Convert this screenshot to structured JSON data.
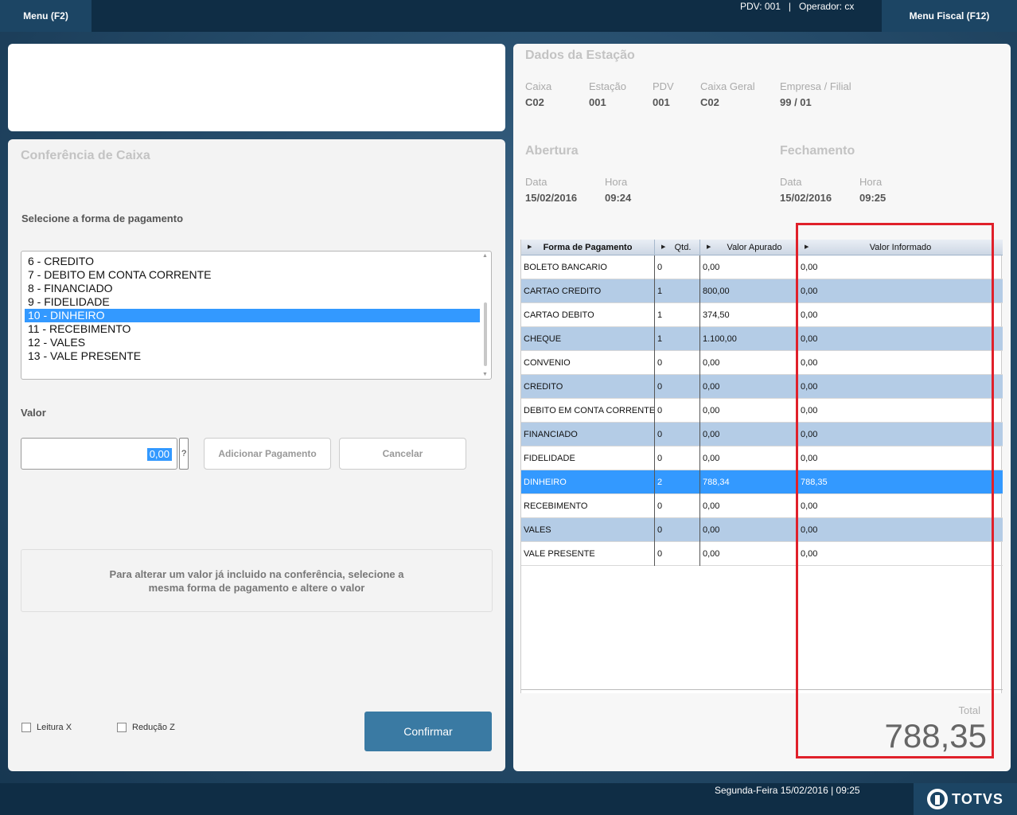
{
  "topbar": {
    "menu_left": "Menu (F2)",
    "menu_right": "Menu Fiscal (F12)",
    "pdv": "PDV: 001",
    "separator": "|",
    "operador": "Operador: cx"
  },
  "left_panel": {
    "title": "Conferência de Caixa",
    "select_label": "Selecione a forma de pagamento",
    "payment_options": [
      "6 - CREDITO",
      "7 - DEBITO EM CONTA CORRENTE",
      "8 - FINANCIADO",
      "9 - FIDELIDADE",
      "10 - DINHEIRO",
      "11 - RECEBIMENTO",
      "12 - VALES",
      "13 - VALE PRESENTE"
    ],
    "selected_option_index": 4,
    "valor_label": "Valor",
    "valor_value": "0,00",
    "help_label": "?",
    "add_button": "Adicionar Pagamento",
    "cancel_button": "Cancelar",
    "info_text": "Para alterar um valor já incluido na conferência, selecione a mesma forma de pagamento e altere o valor",
    "checkbox_leitura": "Leitura X",
    "checkbox_reducao": "Redução Z",
    "confirm_button": "Confirmar"
  },
  "right_panel": {
    "title": "Dados da Estação",
    "fields": {
      "caixa_label": "Caixa",
      "caixa_value": "C02",
      "estacao_label": "Estação",
      "estacao_value": "001",
      "pdv_label": "PDV",
      "pdv_value": "001",
      "caixa_geral_label": "Caixa Geral",
      "caixa_geral_value": "C02",
      "empresa_label": "Empresa / Filial",
      "empresa_value": "99 / 01"
    },
    "abertura": {
      "title": "Abertura",
      "data_label": "Data",
      "data_value": "15/02/2016",
      "hora_label": "Hora",
      "hora_value": "09:24"
    },
    "fechamento": {
      "title": "Fechamento",
      "data_label": "Data",
      "data_value": "15/02/2016",
      "hora_label": "Hora",
      "hora_value": "09:25"
    },
    "table": {
      "headers": [
        "Forma de Pagamento",
        "Qtd.",
        "Valor Apurado",
        "Valor Informado"
      ],
      "rows": [
        [
          "BOLETO BANCARIO",
          "0",
          "0,00",
          "0,00"
        ],
        [
          "CARTAO CREDITO",
          "1",
          "800,00",
          "0,00"
        ],
        [
          "CARTAO DEBITO",
          "1",
          "374,50",
          "0,00"
        ],
        [
          "CHEQUE",
          "1",
          "1.100,00",
          "0,00"
        ],
        [
          "CONVENIO",
          "0",
          "0,00",
          "0,00"
        ],
        [
          "CREDITO",
          "0",
          "0,00",
          "0,00"
        ],
        [
          "DEBITO EM CONTA CORRENTE",
          "0",
          "0,00",
          "0,00"
        ],
        [
          "FINANCIADO",
          "0",
          "0,00",
          "0,00"
        ],
        [
          "FIDELIDADE",
          "0",
          "0,00",
          "0,00"
        ],
        [
          "DINHEIRO",
          "2",
          "788,34",
          "788,35"
        ],
        [
          "RECEBIMENTO",
          "0",
          "0,00",
          "0,00"
        ],
        [
          "VALES",
          "0",
          "0,00",
          "0,00"
        ],
        [
          "VALE PRESENTE",
          "0",
          "0,00",
          "0,00"
        ]
      ],
      "selected_row_index": 9
    },
    "total_label": "Total",
    "total_value": "788,35"
  },
  "footer": {
    "datetime": "Segunda-Feira 15/02/2016 | 09:25",
    "logo_text": "TOTVS"
  },
  "colors": {
    "accent": "#3399ff",
    "alt_row": "#b4cce6",
    "confirm": "#3a7aa3",
    "highlight": "#e0202a"
  }
}
